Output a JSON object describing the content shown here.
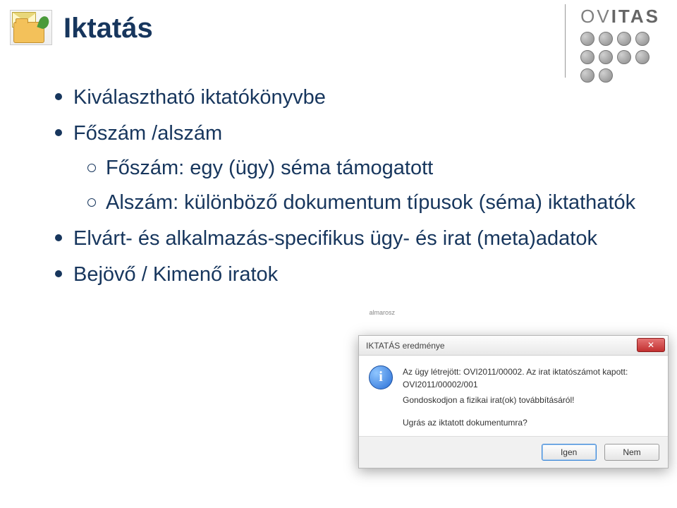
{
  "logo": {
    "text_prefix": "OV",
    "text_bold": "ITAS"
  },
  "title": "Iktatás",
  "bullets": {
    "b1": "Kiválasztható iktatókönyvbe",
    "b2": "Főszám /alszám",
    "b2_sub1": "Főszám: egy (ügy) séma támogatott",
    "b2_sub2": "Alszám: különböző dokumentum típusok (séma) iktathatók",
    "b3": "Elvárt- és alkalmazás-specifikus ügy- és irat (meta)adatok",
    "b4": "Bejövő / Kimenő iratok"
  },
  "floating_label": "almarosz",
  "dialog": {
    "title": "IKTATÁS eredménye",
    "line1": "Az ügy létrejött: OVI2011/00002. Az irat iktatószámot kapott: OVI2011/00002/001",
    "line2": "Gondoskodjon a fizikai irat(ok) továbbításáról!",
    "question": "Ugrás az iktatott dokumentumra?",
    "yes": "Igen",
    "no": "Nem"
  }
}
